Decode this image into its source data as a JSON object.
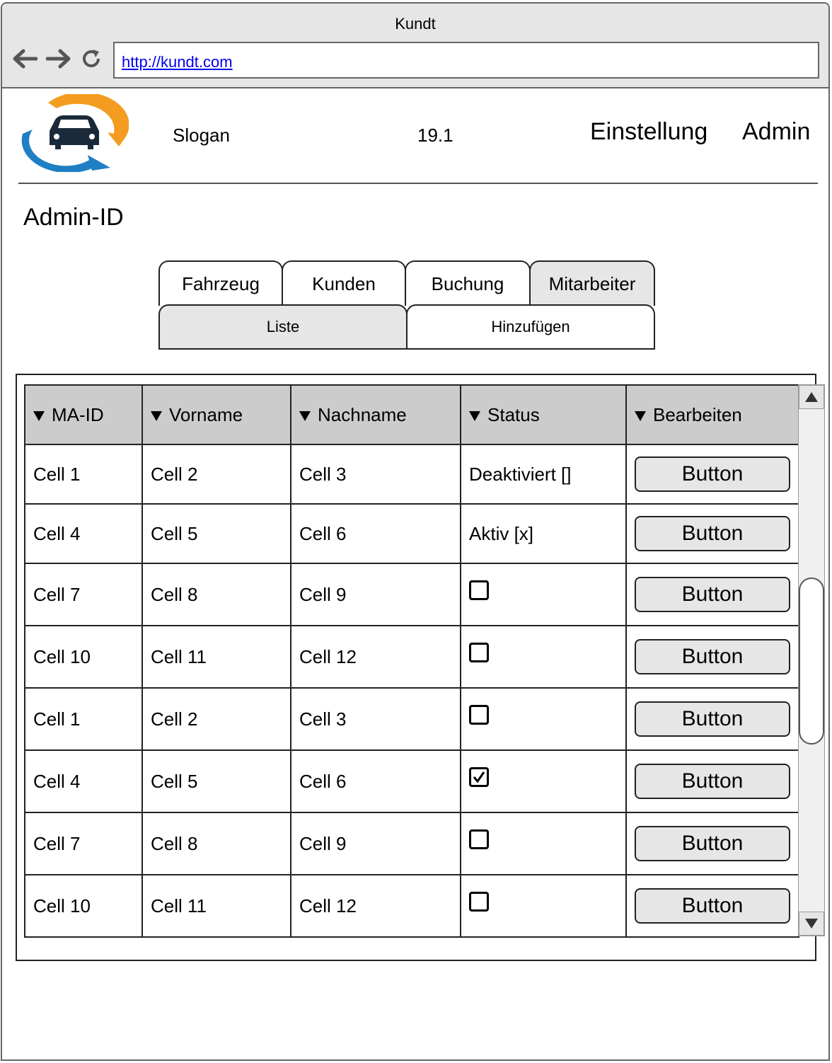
{
  "window": {
    "title": "Kundt"
  },
  "browser": {
    "url": "http://kundt.com",
    "back_icon": "arrow-left-icon",
    "forward_icon": "arrow-right-icon",
    "reload_icon": "reload-icon"
  },
  "header": {
    "slogan": "Slogan",
    "version": "19.1",
    "nav": [
      "Einstellung",
      "Admin"
    ]
  },
  "page": {
    "title": "Admin-ID"
  },
  "tabs": [
    {
      "label": "Fahrzeug",
      "active": false
    },
    {
      "label": "Kunden",
      "active": false
    },
    {
      "label": "Buchung",
      "active": false
    },
    {
      "label": "Mitarbeiter",
      "active": true
    }
  ],
  "subtabs": [
    {
      "label": "Liste",
      "active": true
    },
    {
      "label": "Hinzufügen",
      "active": false
    }
  ],
  "table": {
    "columns": [
      "MA-ID",
      "Vorname",
      "Nachname",
      "Status",
      "Bearbeiten"
    ],
    "rows": [
      {
        "cells": [
          "Cell 1",
          "Cell 2",
          "Cell 3"
        ],
        "status_text": "Deaktiviert []",
        "checked": null,
        "button": "Button"
      },
      {
        "cells": [
          "Cell 4",
          "Cell 5",
          "Cell 6"
        ],
        "status_text": "Aktiv [x]",
        "checked": null,
        "button": "Button"
      },
      {
        "cells": [
          "Cell 7",
          "Cell 8",
          "Cell 9"
        ],
        "status_text": null,
        "checked": false,
        "button": "Button"
      },
      {
        "cells": [
          "Cell 10",
          "Cell 11",
          "Cell 12"
        ],
        "status_text": null,
        "checked": false,
        "button": "Button"
      },
      {
        "cells": [
          "Cell 1",
          "Cell 2",
          "Cell 3"
        ],
        "status_text": null,
        "checked": false,
        "button": "Button"
      },
      {
        "cells": [
          "Cell 4",
          "Cell 5",
          "Cell 6"
        ],
        "status_text": null,
        "checked": true,
        "button": "Button"
      },
      {
        "cells": [
          "Cell 7",
          "Cell 8",
          "Cell 9"
        ],
        "status_text": null,
        "checked": false,
        "button": "Button"
      },
      {
        "cells": [
          "Cell 10",
          "Cell 11",
          "Cell 12"
        ],
        "status_text": null,
        "checked": false,
        "button": "Button"
      }
    ]
  },
  "colors": {
    "logo_blue": "#1e7fc4",
    "logo_orange": "#f39c1f",
    "car": "#1b2a3a",
    "header_gray": "#cccccc"
  }
}
